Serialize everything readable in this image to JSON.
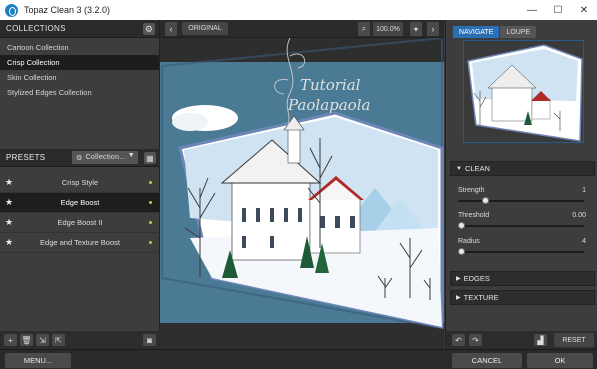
{
  "app": {
    "title": "Topaz Clean 3 (3.2.0)"
  },
  "window": {
    "minimize": "—",
    "maximize": "☐",
    "close": "✕"
  },
  "collections": {
    "header": "COLLECTIONS",
    "items": [
      {
        "label": "Cartoon Collection",
        "selected": false
      },
      {
        "label": "Crisp Collection",
        "selected": true
      },
      {
        "label": "Skin Collection",
        "selected": false
      },
      {
        "label": "Stylized Edges Collection",
        "selected": false
      }
    ]
  },
  "presets": {
    "header": "PRESETS",
    "dropdown": "Collection...",
    "items": [
      {
        "label": "Crisp Style",
        "selected": false
      },
      {
        "label": "Edge Boost",
        "selected": true
      },
      {
        "label": "Edge Boost II",
        "selected": false
      },
      {
        "label": "Edge and Texture Boost",
        "selected": false
      }
    ]
  },
  "toolbar": {
    "original_label": "ORIGINAL",
    "zoom": "100.0%"
  },
  "canvas": {
    "watermark_line1": "Tutorial",
    "watermark_line2": "Paolapaola"
  },
  "navigator": {
    "tabs": [
      {
        "label": "NAVIGATE",
        "active": true
      },
      {
        "label": "LOUPE",
        "active": false
      }
    ]
  },
  "clean": {
    "header": "CLEAN",
    "sliders": [
      {
        "label": "Strength",
        "value": "1",
        "fraction": 0.2
      },
      {
        "label": "Threshold",
        "value": "0.00",
        "fraction": 0.0
      },
      {
        "label": "Radius",
        "value": "4",
        "fraction": 0.0
      }
    ]
  },
  "sections": {
    "edges": "EDGES",
    "texture": "TEXTURE"
  },
  "buttons": {
    "reset": "RESET",
    "menu": "MENU...",
    "cancel": "CANCEL",
    "ok": "OK"
  },
  "colors": {
    "accent": "#2b6fb5",
    "preset_dot": "#b3d334",
    "scene_bg": "#4a7a94"
  }
}
